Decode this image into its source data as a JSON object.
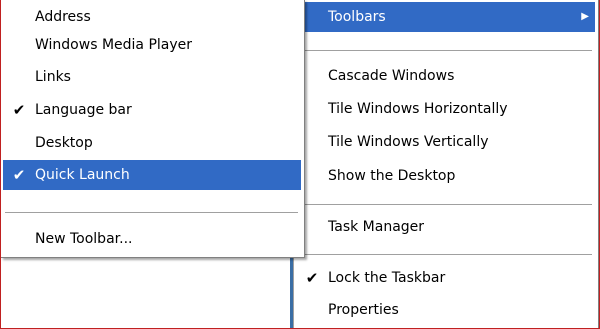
{
  "submenu": {
    "items": [
      {
        "label": "Address",
        "checked": false,
        "highlighted": false
      },
      {
        "label": "Windows Media Player",
        "checked": false,
        "highlighted": false
      },
      {
        "label": "Links",
        "checked": false,
        "highlighted": false
      },
      {
        "label": "Language bar",
        "checked": true,
        "highlighted": false
      },
      {
        "label": "Desktop",
        "checked": false,
        "highlighted": false
      },
      {
        "label": "Quick Launch",
        "checked": true,
        "highlighted": true
      }
    ],
    "new_toolbar_label": "New Toolbar..."
  },
  "main_menu": {
    "toolbars_label": "Toolbars",
    "cascade_label": "Cascade Windows",
    "tile_horizontal_label": "Tile Windows Horizontally",
    "tile_vertical_label": "Tile Windows Vertically",
    "show_desktop_label": "Show the Desktop",
    "task_manager_label": "Task Manager",
    "lock_taskbar_label": "Lock the Taskbar",
    "properties_label": "Properties"
  },
  "glyphs": {
    "check": "✔",
    "submenu_arrow": "▶"
  },
  "colors": {
    "highlight": "#316ac5",
    "frame_border": "#c02020"
  }
}
